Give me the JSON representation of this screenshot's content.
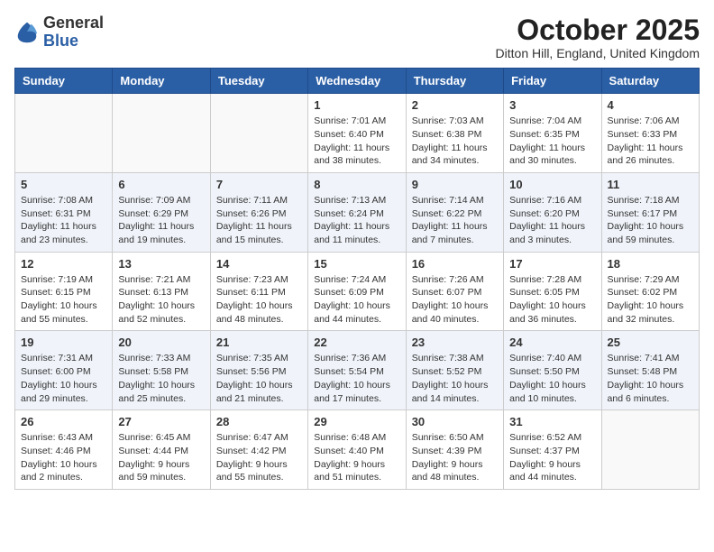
{
  "logo": {
    "general": "General",
    "blue": "Blue"
  },
  "title": "October 2025",
  "location": "Ditton Hill, England, United Kingdom",
  "weekdays": [
    "Sunday",
    "Monday",
    "Tuesday",
    "Wednesday",
    "Thursday",
    "Friday",
    "Saturday"
  ],
  "weeks": [
    [
      {
        "day": "",
        "content": ""
      },
      {
        "day": "",
        "content": ""
      },
      {
        "day": "",
        "content": ""
      },
      {
        "day": "1",
        "content": "Sunrise: 7:01 AM\nSunset: 6:40 PM\nDaylight: 11 hours\nand 38 minutes."
      },
      {
        "day": "2",
        "content": "Sunrise: 7:03 AM\nSunset: 6:38 PM\nDaylight: 11 hours\nand 34 minutes."
      },
      {
        "day": "3",
        "content": "Sunrise: 7:04 AM\nSunset: 6:35 PM\nDaylight: 11 hours\nand 30 minutes."
      },
      {
        "day": "4",
        "content": "Sunrise: 7:06 AM\nSunset: 6:33 PM\nDaylight: 11 hours\nand 26 minutes."
      }
    ],
    [
      {
        "day": "5",
        "content": "Sunrise: 7:08 AM\nSunset: 6:31 PM\nDaylight: 11 hours\nand 23 minutes."
      },
      {
        "day": "6",
        "content": "Sunrise: 7:09 AM\nSunset: 6:29 PM\nDaylight: 11 hours\nand 19 minutes."
      },
      {
        "day": "7",
        "content": "Sunrise: 7:11 AM\nSunset: 6:26 PM\nDaylight: 11 hours\nand 15 minutes."
      },
      {
        "day": "8",
        "content": "Sunrise: 7:13 AM\nSunset: 6:24 PM\nDaylight: 11 hours\nand 11 minutes."
      },
      {
        "day": "9",
        "content": "Sunrise: 7:14 AM\nSunset: 6:22 PM\nDaylight: 11 hours\nand 7 minutes."
      },
      {
        "day": "10",
        "content": "Sunrise: 7:16 AM\nSunset: 6:20 PM\nDaylight: 11 hours\nand 3 minutes."
      },
      {
        "day": "11",
        "content": "Sunrise: 7:18 AM\nSunset: 6:17 PM\nDaylight: 10 hours\nand 59 minutes."
      }
    ],
    [
      {
        "day": "12",
        "content": "Sunrise: 7:19 AM\nSunset: 6:15 PM\nDaylight: 10 hours\nand 55 minutes."
      },
      {
        "day": "13",
        "content": "Sunrise: 7:21 AM\nSunset: 6:13 PM\nDaylight: 10 hours\nand 52 minutes."
      },
      {
        "day": "14",
        "content": "Sunrise: 7:23 AM\nSunset: 6:11 PM\nDaylight: 10 hours\nand 48 minutes."
      },
      {
        "day": "15",
        "content": "Sunrise: 7:24 AM\nSunset: 6:09 PM\nDaylight: 10 hours\nand 44 minutes."
      },
      {
        "day": "16",
        "content": "Sunrise: 7:26 AM\nSunset: 6:07 PM\nDaylight: 10 hours\nand 40 minutes."
      },
      {
        "day": "17",
        "content": "Sunrise: 7:28 AM\nSunset: 6:05 PM\nDaylight: 10 hours\nand 36 minutes."
      },
      {
        "day": "18",
        "content": "Sunrise: 7:29 AM\nSunset: 6:02 PM\nDaylight: 10 hours\nand 32 minutes."
      }
    ],
    [
      {
        "day": "19",
        "content": "Sunrise: 7:31 AM\nSunset: 6:00 PM\nDaylight: 10 hours\nand 29 minutes."
      },
      {
        "day": "20",
        "content": "Sunrise: 7:33 AM\nSunset: 5:58 PM\nDaylight: 10 hours\nand 25 minutes."
      },
      {
        "day": "21",
        "content": "Sunrise: 7:35 AM\nSunset: 5:56 PM\nDaylight: 10 hours\nand 21 minutes."
      },
      {
        "day": "22",
        "content": "Sunrise: 7:36 AM\nSunset: 5:54 PM\nDaylight: 10 hours\nand 17 minutes."
      },
      {
        "day": "23",
        "content": "Sunrise: 7:38 AM\nSunset: 5:52 PM\nDaylight: 10 hours\nand 14 minutes."
      },
      {
        "day": "24",
        "content": "Sunrise: 7:40 AM\nSunset: 5:50 PM\nDaylight: 10 hours\nand 10 minutes."
      },
      {
        "day": "25",
        "content": "Sunrise: 7:41 AM\nSunset: 5:48 PM\nDaylight: 10 hours\nand 6 minutes."
      }
    ],
    [
      {
        "day": "26",
        "content": "Sunrise: 6:43 AM\nSunset: 4:46 PM\nDaylight: 10 hours\nand 2 minutes."
      },
      {
        "day": "27",
        "content": "Sunrise: 6:45 AM\nSunset: 4:44 PM\nDaylight: 9 hours\nand 59 minutes."
      },
      {
        "day": "28",
        "content": "Sunrise: 6:47 AM\nSunset: 4:42 PM\nDaylight: 9 hours\nand 55 minutes."
      },
      {
        "day": "29",
        "content": "Sunrise: 6:48 AM\nSunset: 4:40 PM\nDaylight: 9 hours\nand 51 minutes."
      },
      {
        "day": "30",
        "content": "Sunrise: 6:50 AM\nSunset: 4:39 PM\nDaylight: 9 hours\nand 48 minutes."
      },
      {
        "day": "31",
        "content": "Sunrise: 6:52 AM\nSunset: 4:37 PM\nDaylight: 9 hours\nand 44 minutes."
      },
      {
        "day": "",
        "content": ""
      }
    ]
  ]
}
